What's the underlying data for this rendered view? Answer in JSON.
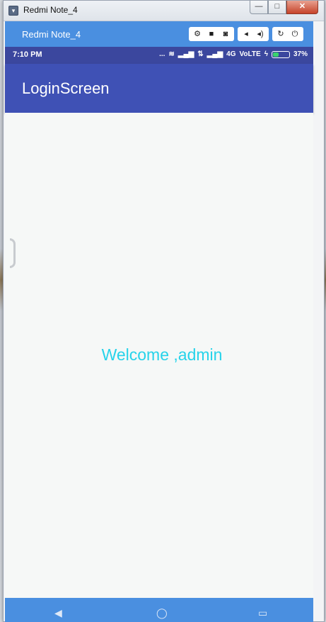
{
  "window": {
    "title": "Redmi Note_4",
    "controls": {
      "minimize": "—",
      "maximize": "□",
      "close": "✕"
    }
  },
  "emulator": {
    "device_name": "Redmi Note_4",
    "tools": [
      "settings-icon",
      "video-icon",
      "camera-icon",
      "volume-down-icon",
      "volume-up-icon",
      "rotate-icon",
      "power-icon"
    ]
  },
  "status_bar": {
    "time": "7:10 PM",
    "dots": "...",
    "network": "4G",
    "volte": "VoLTE",
    "battery_percent": "37%",
    "battery_level": 0.37
  },
  "app": {
    "title": "LoginScreen",
    "welcome_text": "Welcome ,admin"
  },
  "colors": {
    "app_bar": "#3f51b5",
    "status_bar": "#3b479e",
    "emulator_bar": "#4a8fe0",
    "welcome_text": "#27d3ea"
  }
}
